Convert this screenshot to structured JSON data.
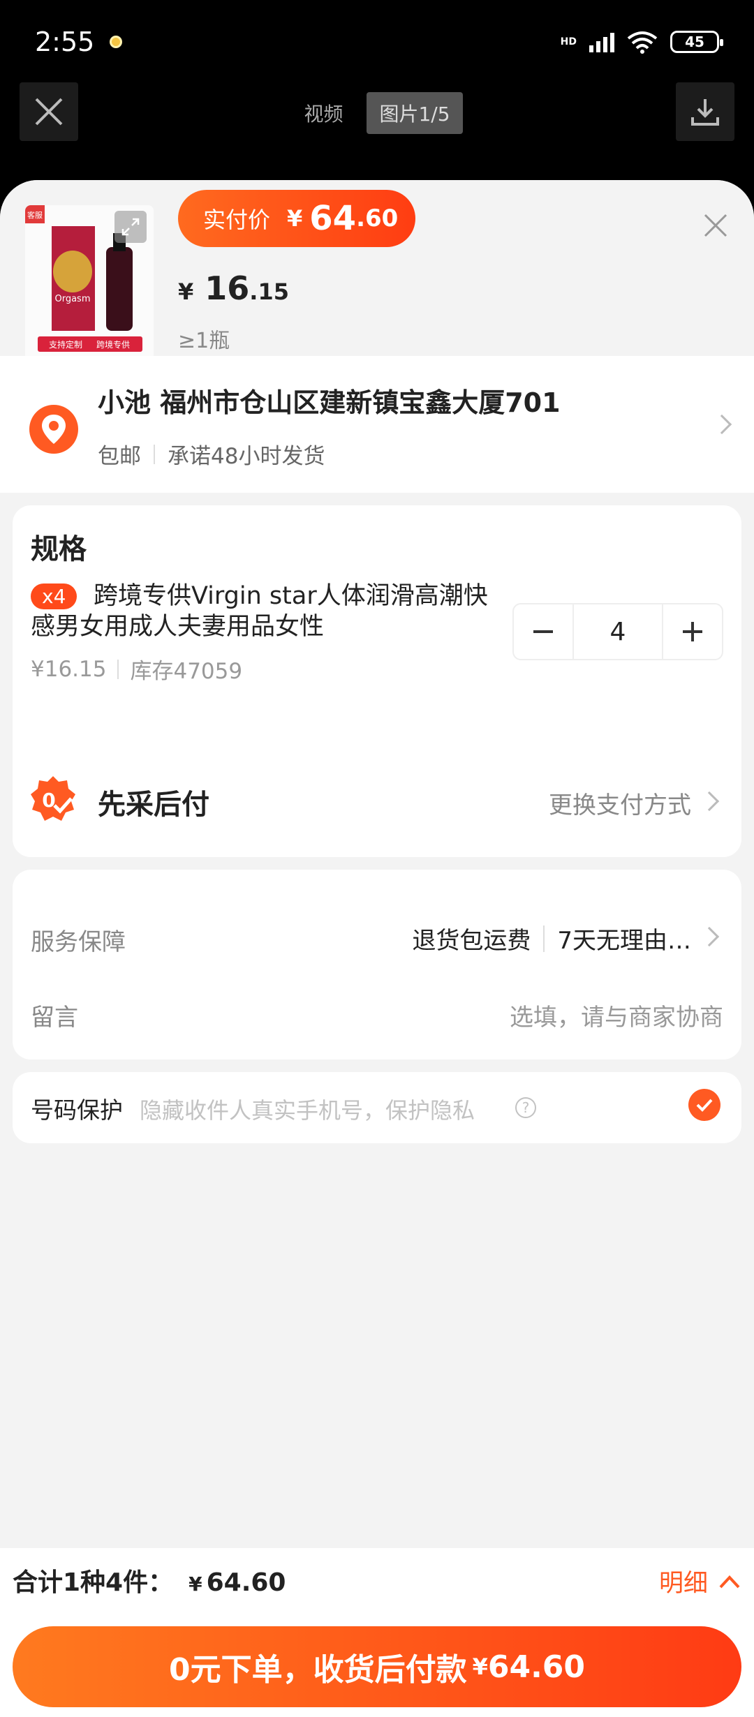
{
  "status_bar": {
    "time": "2:55",
    "network": "HD",
    "battery": "45"
  },
  "top_nav": {
    "tabs": [
      {
        "label": "视频"
      },
      {
        "label": "图片1/5"
      }
    ]
  },
  "product": {
    "thumb_badge": "客服",
    "thumb_tag_a": "支持定制",
    "thumb_tag_b": "跨境专供",
    "thumb_name": "Orgasm",
    "paid_label": "实付价",
    "paid_yen": "¥",
    "paid_int": "64",
    "paid_dec": ".60",
    "unit_yen": "¥",
    "unit_int": "16",
    "unit_dec": ".15",
    "min_qty": "≥1瓶"
  },
  "address": {
    "main": "小池 福州市仓山区建新镇宝鑫大厦701",
    "shipping": "包邮",
    "promise": "承诺48小时发货"
  },
  "spec": {
    "title": "规格",
    "badge": "x4",
    "name": "跨境专供Virgin star人体润滑高潮快感男女用成人夫妻用品女性",
    "price": "¥16.15",
    "stock": "库存47059",
    "quantity": "4"
  },
  "payment": {
    "label": "先采后付",
    "change": "更换支付方式"
  },
  "service": {
    "label": "服务保障",
    "item_a": "退货包运费",
    "item_b": "7天无理由…"
  },
  "message": {
    "label": "留言",
    "placeholder": "选填，请与商家协商"
  },
  "privacy": {
    "label": "号码保护",
    "hint": "隐藏收件人真实手机号，保护隐私"
  },
  "footer": {
    "total_label": "合计1种4件：",
    "total_yen": "¥",
    "total_amount": "64.60",
    "detail": "明细",
    "cta_text": "0元下单，收货后付款",
    "cta_yen": "¥",
    "cta_amount": "64.60"
  },
  "colors": {
    "accent": "#ff5a22",
    "accent_dark": "#ff3b14"
  }
}
